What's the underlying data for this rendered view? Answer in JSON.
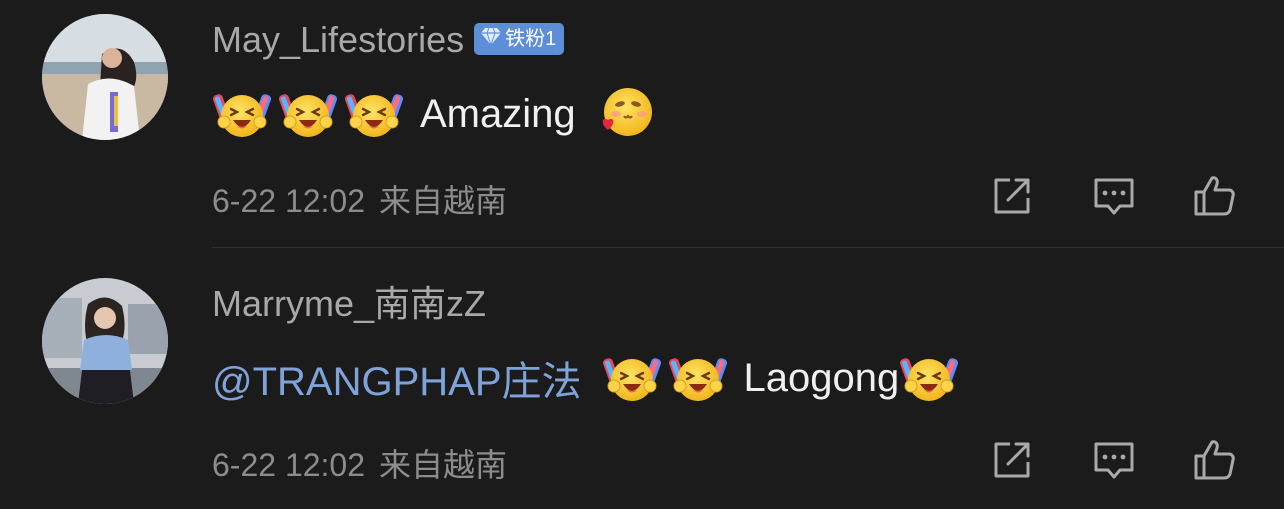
{
  "comments": [
    {
      "username": "May_Lifestories",
      "badge": "铁粉1",
      "text_after_emojis": "Amazing",
      "emojis": [
        "cheering-emoji",
        "cheering-emoji",
        "cheering-emoji",
        "love-emoji"
      ],
      "timestamp": "6-22 12:02",
      "location": "来自越南"
    },
    {
      "username": "Marryme_南南zZ",
      "mention": "@TRANGPHAP庄法",
      "text_after_emojis": "Laogong",
      "emojis": [
        "cheering-emoji",
        "cheering-emoji",
        "cheering-emoji"
      ],
      "timestamp": "6-22 12:02",
      "location": "来自越南"
    }
  ],
  "icons": {
    "share": "share-icon",
    "reply": "comment-icon",
    "like": "thumbs-up-icon"
  },
  "colors": {
    "background": "#1b1b1b",
    "username": "#a8a8a8",
    "badge": "#5d8fd8",
    "mention": "#7fa3d9",
    "meta": "#8c8c8c"
  }
}
